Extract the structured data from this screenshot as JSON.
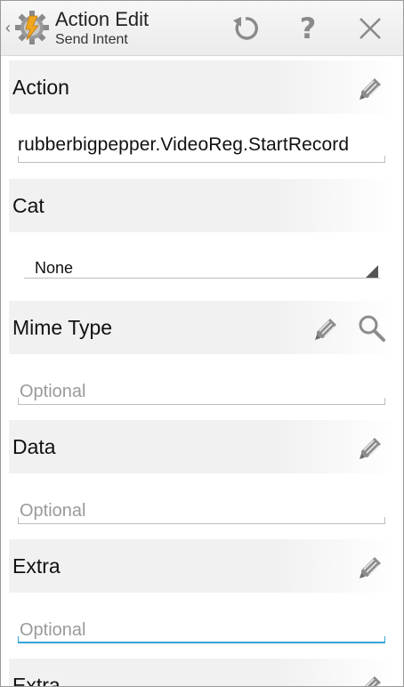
{
  "header": {
    "title": "Action Edit",
    "subtitle": "Send Intent",
    "up_glyph": "‹",
    "app_icon": "tasker-gear-icon",
    "undo_icon": "undo-icon",
    "help_glyph": "?",
    "close_icon": "close-icon"
  },
  "sections": {
    "action": {
      "label": "Action",
      "value": "rubberbigpepper.VideoReg.StartRecord"
    },
    "cat": {
      "label": "Cat",
      "selected": "None"
    },
    "mime": {
      "label": "Mime Type",
      "placeholder": "Optional"
    },
    "data": {
      "label": "Data",
      "placeholder": "Optional"
    },
    "extra1": {
      "label": "Extra",
      "placeholder": "Optional"
    },
    "extra2": {
      "label": "Extra"
    }
  },
  "colors": {
    "section_bg": "#f1f1f1",
    "focus_accent": "#33a6d6",
    "icon_gray": "#8c8c8c"
  }
}
